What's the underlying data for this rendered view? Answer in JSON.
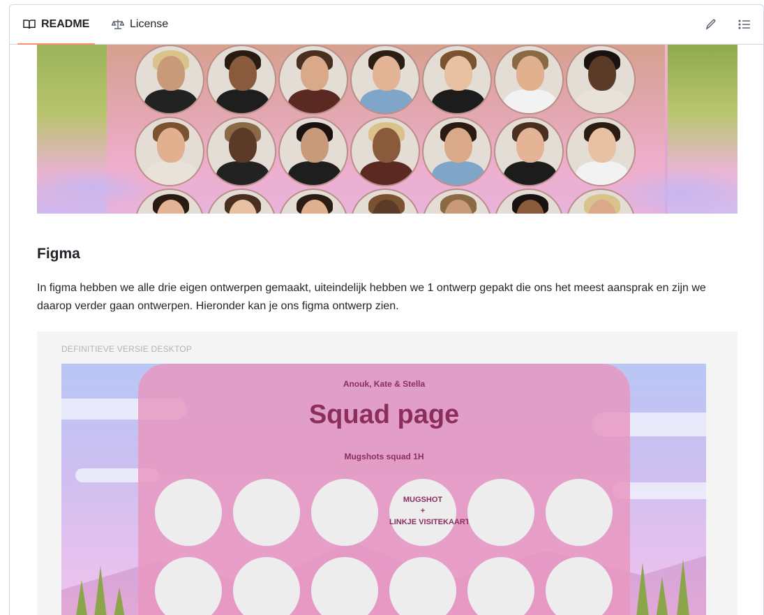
{
  "tabs": {
    "readme": "README",
    "license": "License"
  },
  "toolbar": {
    "edit_icon": "pencil-icon",
    "outline_icon": "list-unordered-icon"
  },
  "banner": {
    "rows": [
      [
        "p1",
        "p2",
        "p3",
        "p4",
        "p5",
        "p6",
        "p7"
      ],
      [
        "p8",
        "p9",
        "p10",
        "p11",
        "p12",
        "p13",
        "p14"
      ],
      [
        "p15",
        "p16",
        "p17",
        "p18",
        "p19",
        "p20",
        "p21"
      ]
    ]
  },
  "figma_section": {
    "heading": "Figma",
    "paragraph": "In figma hebben we alle drie eigen ontwerpen gemaakt, uiteindelijk hebben we 1 ontwerp gepakt die ons het meest aansprak en zijn we daarop verder gaan ontwerpen. Hieronder kan je ons figma ontwerp zien."
  },
  "figma_image": {
    "frame_label": "DEFINITIEVE VERSIE DESKTOP",
    "names": "Anouk, Kate & Stella",
    "title": "Squad page",
    "subtitle": "Mugshots squad 1H",
    "slot_line1": "MUGSHOT",
    "slot_line2": "+",
    "slot_line3": "LINKJE VISITEKAARTJE"
  },
  "colors": {
    "tab_underline": "#fd8c73",
    "card_text": "#8b2e5c"
  }
}
